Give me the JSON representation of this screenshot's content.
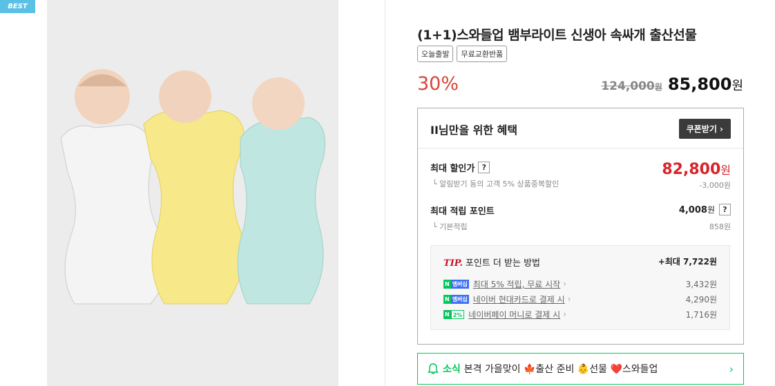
{
  "badge": "BEST",
  "product": {
    "title": "(1+1)스와들업 뱀부라이트 신생아 속싸개 출산선물",
    "tags": [
      "오늘출발",
      "무료교환반품"
    ],
    "discount_rate": "30%",
    "original_price": "124,000",
    "original_unit": "원",
    "sale_price": "85,800",
    "sale_unit": "원"
  },
  "benefit": {
    "title": "II님만을 위한 혜택",
    "coupon_button": "쿠폰받기 ›",
    "max_price_label": "최대 할인가",
    "max_price": "82,800",
    "max_price_unit": "원",
    "max_price_sub": "알림받기 동의 고객 5% 상품중복할인",
    "max_price_sub_value": "-3,000원",
    "points_label": "최대 적립 포인트",
    "points_value": "4,008",
    "points_unit": "원",
    "points_sub": "기본적립",
    "points_sub_value": "858원",
    "help": "?"
  },
  "tip": {
    "mark": "TIP.",
    "title": "포인트 더 받는 방법",
    "max": "+최대 7,722원",
    "items": [
      {
        "badge_a": "N",
        "badge_b": "멤버십",
        "text": "최대 5% 적립, 무료 시작",
        "amount": "3,432원"
      },
      {
        "badge_a": "N",
        "badge_b": "멤버십",
        "text": "네이버 현대카드로 결제 시",
        "amount": "4,290원"
      },
      {
        "badge_a": "N",
        "badge_b": "2%",
        "text": "네이버페이 머니로 결제 시",
        "amount": "1,716원"
      }
    ]
  },
  "news": {
    "label": "소식",
    "text": "본격 가을맞이 🍁출산 준비 👶선물 ❤️스와들업"
  },
  "colors": {
    "accent_green": "#03c75a",
    "price_red": "#d8232a",
    "badge_blue": "#5bc0e6"
  }
}
